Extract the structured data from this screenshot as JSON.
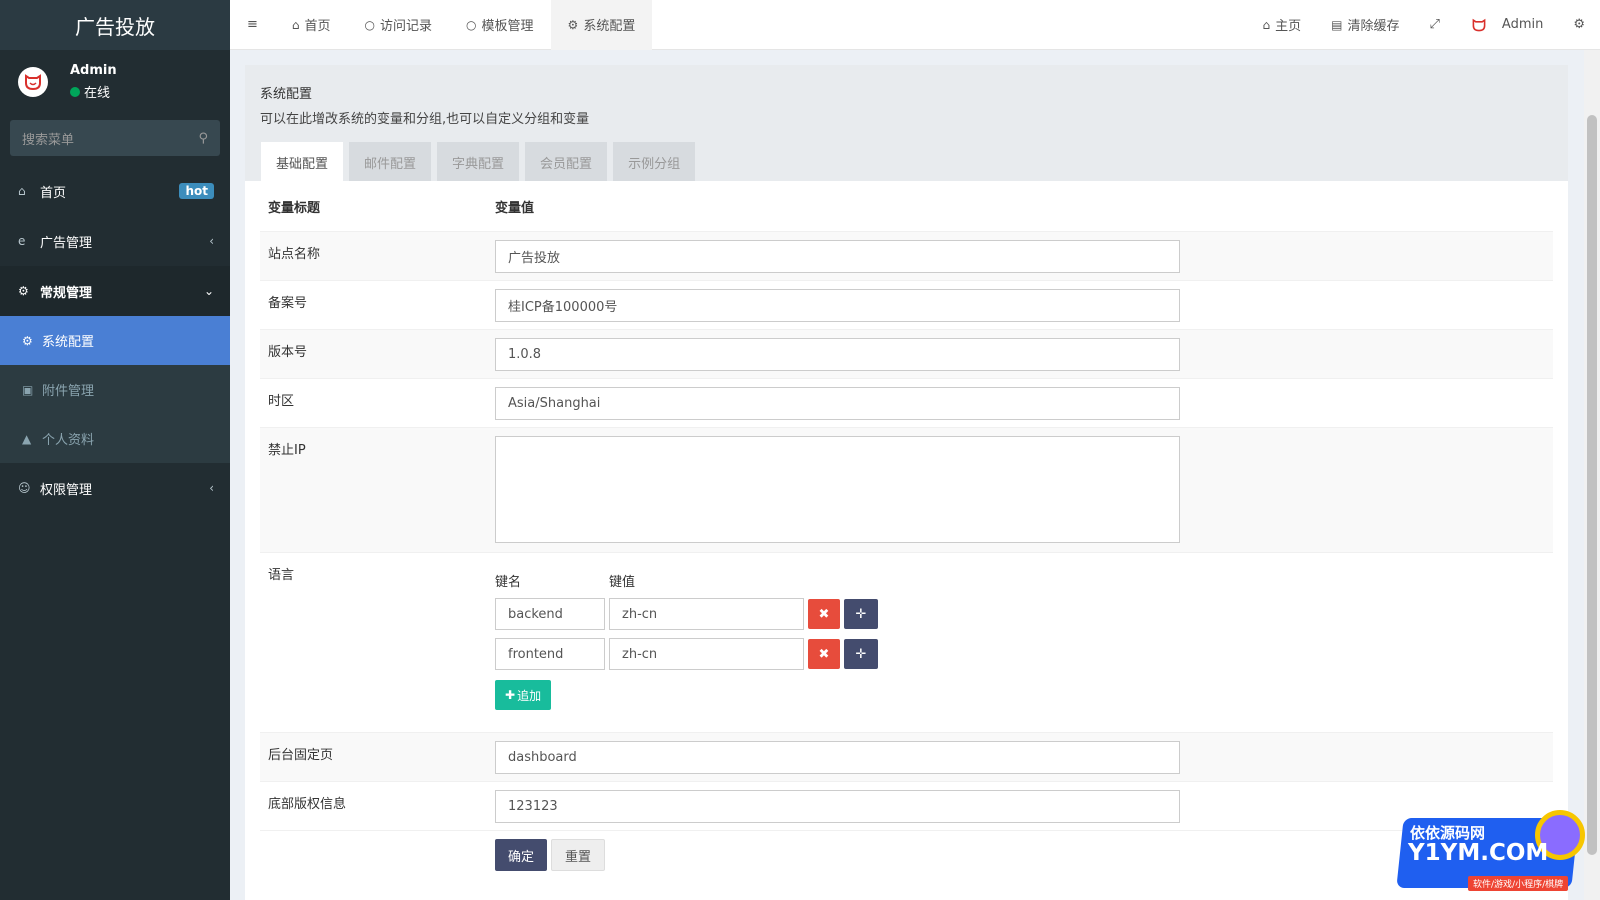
{
  "app": {
    "title": "广告投放",
    "user_name": "Admin",
    "user_status": "在线"
  },
  "sidebar": {
    "search_placeholder": "搜索菜单",
    "items": [
      {
        "label": "首页",
        "icon": "home-icon",
        "badge": "hot"
      },
      {
        "label": "广告管理",
        "icon": "ie-icon"
      },
      {
        "label": "常规管理",
        "icon": "cogs-icon"
      },
      {
        "label": "权限管理",
        "icon": "group-icon"
      }
    ],
    "subitems": [
      {
        "label": "系统配置",
        "icon": "gear-icon"
      },
      {
        "label": "附件管理",
        "icon": "image-icon"
      },
      {
        "label": "个人资料",
        "icon": "user-icon"
      }
    ]
  },
  "topbar": {
    "tabs": [
      {
        "label": "首页",
        "icon": "home-icon"
      },
      {
        "label": "访问记录",
        "icon": "circle-icon"
      },
      {
        "label": "模板管理",
        "icon": "circle-icon"
      },
      {
        "label": "系统配置",
        "icon": "gear-icon"
      }
    ],
    "home_label": "主页",
    "clear_cache_label": "清除缓存",
    "admin_label": "Admin"
  },
  "panel": {
    "title": "系统配置",
    "desc": "可以在此增改系统的变量和分组,也可以自定义分组和变量",
    "tabs": [
      "基础配置",
      "邮件配置",
      "字典配置",
      "会员配置",
      "示例分组"
    ],
    "col_title": "变量标题",
    "col_value": "变量值"
  },
  "form": {
    "site_name_label": "站点名称",
    "site_name": "广告投放",
    "beian_label": "备案号",
    "beian": "桂ICP备100000号",
    "version_label": "版本号",
    "version": "1.0.8",
    "timezone_label": "时区",
    "timezone": "Asia/Shanghai",
    "forbid_ip_label": "禁止IP",
    "language_label": "语言",
    "key_header": "键名",
    "value_header": "键值",
    "languages": [
      {
        "key": "backend",
        "value": "zh-cn"
      },
      {
        "key": "frontend",
        "value": "zh-cn"
      }
    ],
    "add_label": "追加",
    "fixed_page_label": "后台固定页",
    "fixed_page": "dashboard",
    "copyright_label": "底部版权信息",
    "copyright": "123123",
    "ok_label": "确定",
    "reset_label": "重置"
  },
  "watermark": {
    "line1": "依依源码网",
    "line2": "Y1YM.COM",
    "line3": "软件/游戏/小程序/棋牌"
  }
}
